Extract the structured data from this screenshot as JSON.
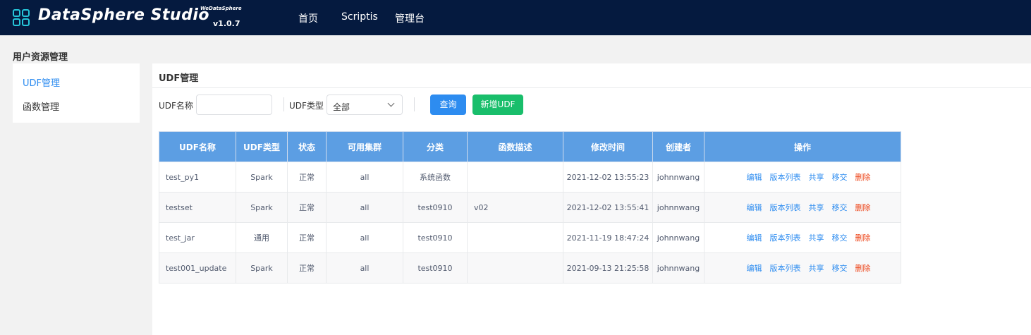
{
  "header": {
    "logo_text": "DataSphere Studio",
    "logo_sub": "WeDataSphere",
    "version": "v1.0.7",
    "nav": [
      "首页",
      "Scriptis",
      "管理台"
    ]
  },
  "page_title": "用户资源管理",
  "left_menu": [
    "UDF管理",
    "函数管理"
  ],
  "main": {
    "title": "UDF管理",
    "filters": {
      "name_label": "UDF名称",
      "name_value": "",
      "type_label": "UDF类型",
      "type_value": "全部"
    },
    "buttons": {
      "query": "查询",
      "add": "新增UDF"
    }
  },
  "table": {
    "columns": [
      "UDF名称",
      "UDF类型",
      "状态",
      "可用集群",
      "分类",
      "函数描述",
      "修改时间",
      "创建者",
      "操作"
    ],
    "rows": [
      [
        "test_py1",
        "Spark",
        "正常",
        "all",
        "系统函数",
        "",
        "2021-12-02 13:55:23",
        "johnnwang"
      ],
      [
        "testset",
        "Spark",
        "正常",
        "all",
        "test0910",
        "v02",
        "2021-12-02 13:55:41",
        "johnnwang"
      ],
      [
        "test_jar",
        "通用",
        "正常",
        "all",
        "test0910",
        "",
        "2021-11-19 18:47:24",
        "johnnwang"
      ],
      [
        "test001_update",
        "Spark",
        "正常",
        "all",
        "test0910",
        "",
        "2021-09-13 21:25:58",
        "johnnwang"
      ]
    ],
    "actions": [
      "编辑",
      "版本列表",
      "共享",
      "移交",
      "删除"
    ]
  },
  "colors": {
    "header_bg": "#051a3f",
    "accent": "#2d8cf0",
    "success": "#19be6b",
    "danger": "#ed4014",
    "table_header": "#5c9ee3",
    "logo_icon": "#26c6da"
  }
}
